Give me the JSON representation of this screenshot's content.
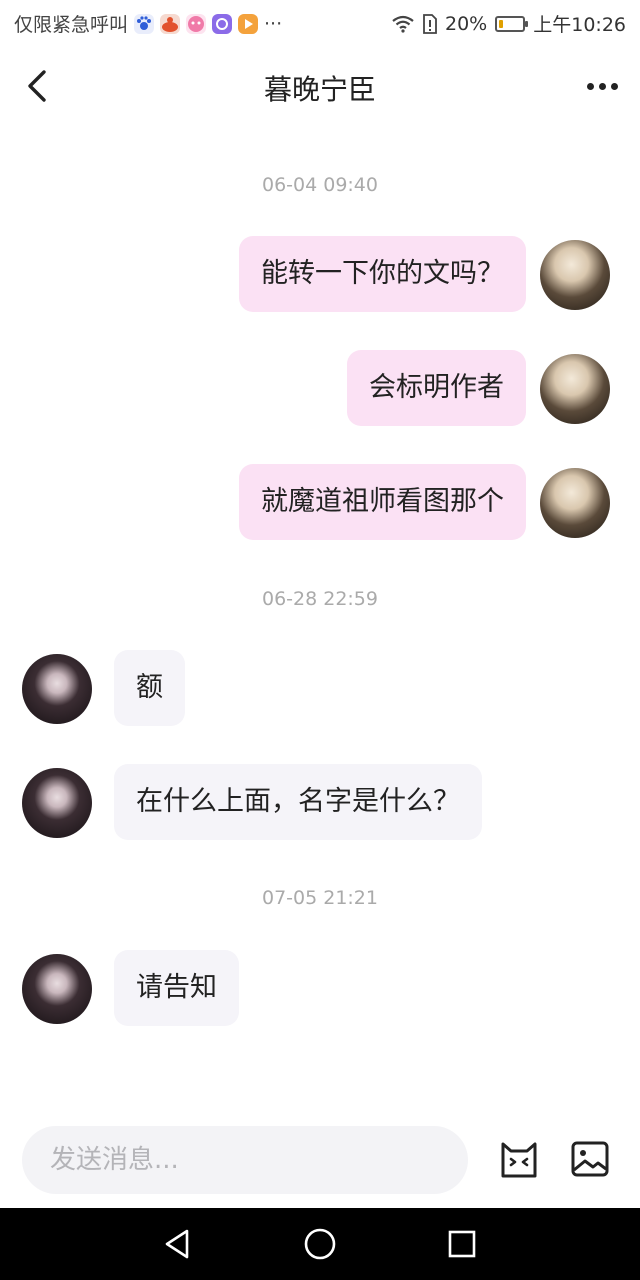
{
  "status_bar": {
    "carrier": "仅限紧急呼叫",
    "overflow": "···",
    "battery_percent": "20%",
    "time": "上午10:26",
    "battery_level": 0.2,
    "app_icons": [
      "baidu-icon",
      "app-red-icon",
      "app-pink-icon",
      "app-purple-icon",
      "app-orange-icon"
    ]
  },
  "header": {
    "title": "暮晚宁臣"
  },
  "messages": [
    {
      "type": "timestamp",
      "text": "06-04 09:40"
    },
    {
      "type": "message",
      "side": "me",
      "text": "能转一下你的文吗？"
    },
    {
      "type": "message",
      "side": "me",
      "text": "会标明作者"
    },
    {
      "type": "message",
      "side": "me",
      "text": "就魔道祖师看图那个"
    },
    {
      "type": "timestamp",
      "text": "06-28 22:59"
    },
    {
      "type": "message",
      "side": "them",
      "text": "额"
    },
    {
      "type": "message",
      "side": "them",
      "text": "在什么上面，名字是什么？"
    },
    {
      "type": "timestamp",
      "text": "07-05 21:21"
    },
    {
      "type": "message",
      "side": "them",
      "text": "请告知"
    }
  ],
  "input": {
    "placeholder": "发送消息..."
  },
  "colors": {
    "my_bubble": "#fbe1f4",
    "their_bubble": "#f5f4f9",
    "timestamp_text": "#aaaaaa"
  }
}
